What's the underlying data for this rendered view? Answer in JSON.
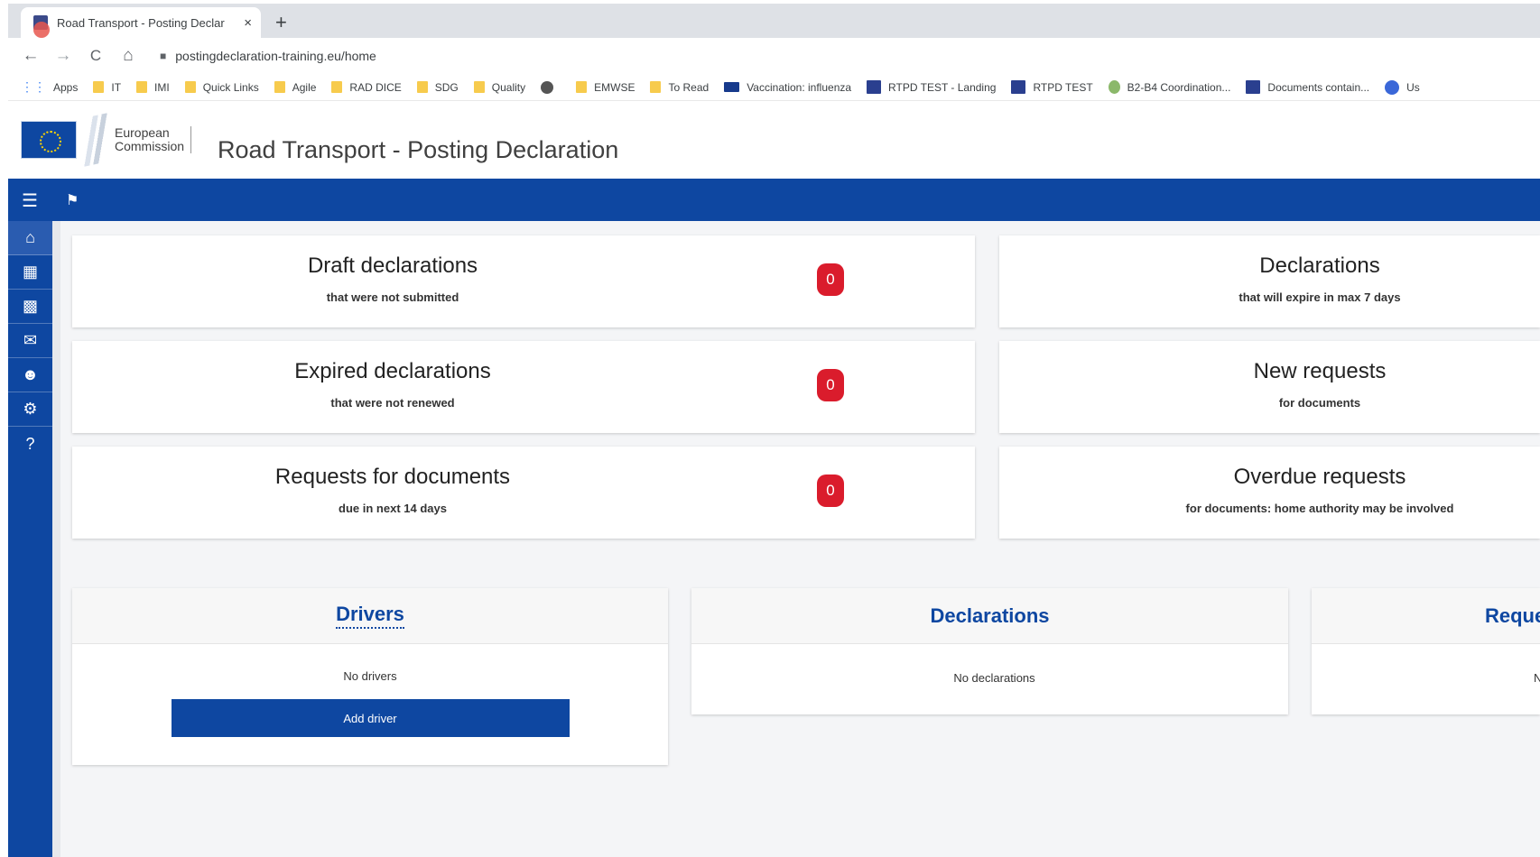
{
  "browser": {
    "tab_title": "Road Transport - Posting Declar",
    "close_glyph": "×",
    "new_tab_glyph": "+",
    "url": "postingdeclaration-training.eu/home",
    "nav": {
      "back": "←",
      "forward": "→",
      "reload": "C",
      "home": "⌂"
    },
    "bookmarks": [
      {
        "label": "Apps",
        "icon": "apps-grid-icon"
      },
      {
        "label": "IT",
        "icon": "folder-icon"
      },
      {
        "label": "IMI",
        "icon": "folder-icon"
      },
      {
        "label": "Quick Links",
        "icon": "folder-icon"
      },
      {
        "label": "Agile",
        "icon": "folder-icon"
      },
      {
        "label": "RAD DICE",
        "icon": "folder-icon"
      },
      {
        "label": "SDG",
        "icon": "folder-icon"
      },
      {
        "label": "Quality",
        "icon": "folder-icon"
      },
      {
        "label": "",
        "icon": "globe-icon"
      },
      {
        "label": "EMWSE",
        "icon": "folder-icon"
      },
      {
        "label": "To Read",
        "icon": "folder-icon"
      },
      {
        "label": "Vaccination: influenza",
        "icon": "eu-flag-icon"
      },
      {
        "label": "RTPD TEST - Landing",
        "icon": "site-icon"
      },
      {
        "label": "RTPD TEST",
        "icon": "site-icon"
      },
      {
        "label": "B2-B4 Coordination...",
        "icon": "leaf-icon"
      },
      {
        "label": "Documents contain...",
        "icon": "site-icon"
      },
      {
        "label": "Us",
        "icon": "circle-icon"
      }
    ]
  },
  "header": {
    "logo_line1": "European",
    "logo_line2": "Commission",
    "app_title": "Road Transport - Posting Declaration"
  },
  "colors": {
    "primary": "#0e47a1",
    "badge": "#da1c2c",
    "background": "#f4f5f7"
  },
  "stats": [
    {
      "title": "Draft declarations",
      "subtitle": "that were not submitted",
      "count": "0"
    },
    {
      "title": "Declarations",
      "subtitle": "that will expire in max 7 days"
    },
    {
      "title": "Expired declarations",
      "subtitle": "that were not renewed",
      "count": "0"
    },
    {
      "title": "New requests",
      "subtitle": "for documents"
    },
    {
      "title": "Requests for documents",
      "subtitle": "due in next 14 days",
      "count": "0"
    },
    {
      "title": "Overdue requests",
      "subtitle": "for documents: home authority may be involved"
    }
  ],
  "panels": {
    "drivers": {
      "title": "Drivers",
      "empty": "No drivers",
      "button": "Add driver"
    },
    "declarations": {
      "title": "Declarations",
      "empty": "No declarations"
    },
    "requests": {
      "title": "Requests",
      "empty": "No requests"
    }
  }
}
